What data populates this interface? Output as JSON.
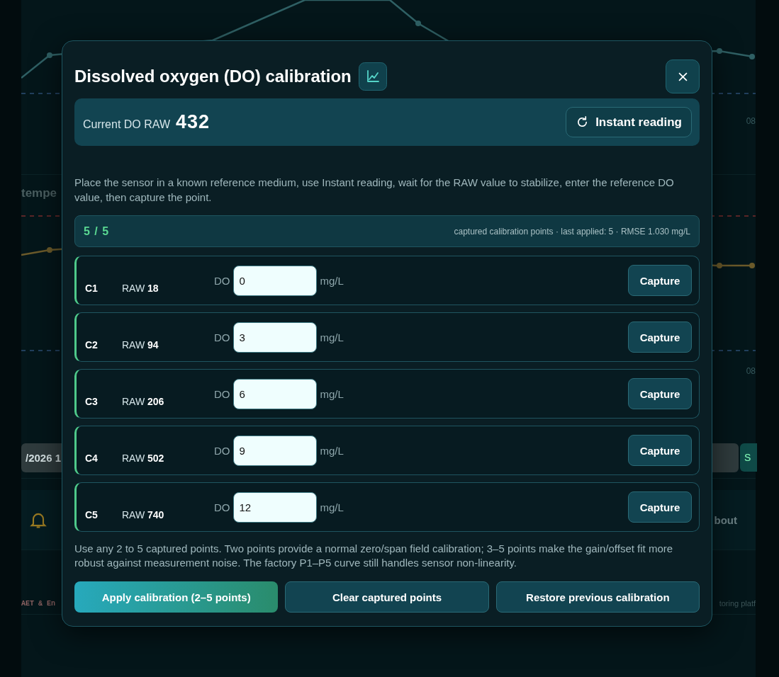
{
  "background": {
    "chart_1": {
      "axis_label": "08"
    },
    "chart_2": {
      "title": "tempe",
      "axis_label": "08"
    },
    "filter": {
      "date_value": "/2026 1",
      "button": "S"
    },
    "nav": {
      "link": "bout"
    },
    "footer": {
      "left": "AET & En",
      "right": "toring platf"
    }
  },
  "dialog": {
    "title": "Dissolved oxygen (DO) calibration",
    "current": {
      "label": "Current DO RAW",
      "value": "432"
    },
    "instant_button": "Instant reading",
    "instructions": "Place the sensor in a known reference medium, use Instant reading, wait for the RAW value to stabilize, enter the reference DO value, then capture the point.",
    "progress": {
      "count": "5 / 5",
      "summary": "captured calibration points · last applied: 5 · RMSE 1.030 mg/L"
    },
    "points": [
      {
        "id": "C1",
        "raw_label": "RAW",
        "raw": "18",
        "do_label": "DO",
        "value": "0",
        "unit": "mg/L",
        "button": "Capture",
        "captured": true
      },
      {
        "id": "C2",
        "raw_label": "RAW",
        "raw": "94",
        "do_label": "DO",
        "value": "3",
        "unit": "mg/L",
        "button": "Capture",
        "captured": true
      },
      {
        "id": "C3",
        "raw_label": "RAW",
        "raw": "206",
        "do_label": "DO",
        "value": "6",
        "unit": "mg/L",
        "button": "Capture",
        "captured": true
      },
      {
        "id": "C4",
        "raw_label": "RAW",
        "raw": "502",
        "do_label": "DO",
        "value": "9",
        "unit": "mg/L",
        "button": "Capture",
        "captured": true
      },
      {
        "id": "C5",
        "raw_label": "RAW",
        "raw": "740",
        "do_label": "DO",
        "value": "12",
        "unit": "mg/L",
        "button": "Capture",
        "captured": true
      }
    ],
    "note": "Use any 2 to 5 captured points. Two points provide a normal zero/span field calibration; 3–5 points make the gain/offset fit more robust against measurement noise. The factory P1–P5 curve still handles sensor non-linearity.",
    "actions": [
      {
        "label": "Apply calibration (2–5 points)",
        "kind": "primary"
      },
      {
        "label": "Clear captured points",
        "kind": "secondary"
      },
      {
        "label": "Restore previous calibration",
        "kind": "secondary"
      }
    ]
  }
}
